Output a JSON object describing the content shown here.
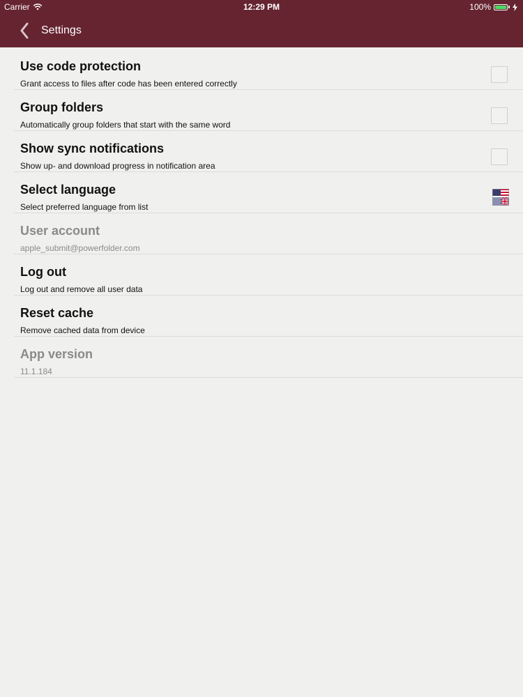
{
  "status_bar": {
    "carrier": "Carrier",
    "time": "12:29 PM",
    "battery": "100%",
    "icons": [
      "wifi-icon",
      "battery-icon",
      "charging-icon"
    ],
    "battery_color": "#4cd964"
  },
  "nav": {
    "title": "Settings",
    "back_icon": "chevron-left-icon",
    "bar_color": "#652430"
  },
  "settings": [
    {
      "title": "Use code protection",
      "subtitle": "Grant access to files after code has been entered correctly",
      "control": "checkbox",
      "checked": false,
      "enabled": true
    },
    {
      "title": "Group folders",
      "subtitle": "Automatically group folders that start with the same word",
      "control": "checkbox",
      "checked": false,
      "enabled": true
    },
    {
      "title": "Show sync notifications",
      "subtitle": "Show up- and download progress in notification area",
      "control": "checkbox",
      "checked": false,
      "enabled": true
    },
    {
      "title": "Select language",
      "subtitle": "Select preferred language from list",
      "control": "flag-icon",
      "enabled": true
    },
    {
      "title": "User account",
      "subtitle": "apple_submit@powerfolder.com",
      "enabled": false
    },
    {
      "title": "Log out",
      "subtitle": "Log out and remove all user data",
      "enabled": true
    },
    {
      "title": "Reset cache",
      "subtitle": "Remove cached data from device",
      "enabled": true
    },
    {
      "title": "App version",
      "subtitle": "11.1.184",
      "enabled": false
    }
  ]
}
